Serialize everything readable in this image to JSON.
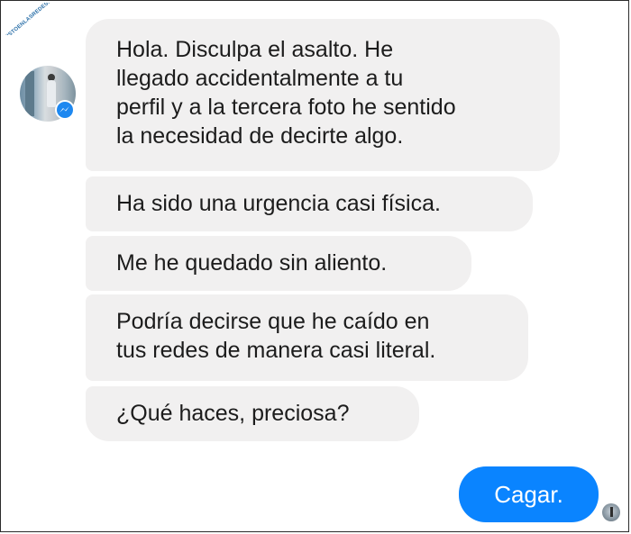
{
  "watermark": {
    "text": "VISTOENLASREDES.COM"
  },
  "conversation": {
    "received": [
      {
        "lines": [
          "Hola. Disculpa el asalto. He",
          "llegado accidentalmente a tu",
          "perfil y a la tercera foto he sentido",
          "la necesidad de decirte algo."
        ]
      },
      {
        "lines": [
          "Ha sido una urgencia casi física."
        ]
      },
      {
        "lines": [
          "Me he quedado sin aliento."
        ]
      },
      {
        "lines": [
          "Podría decirse que he caído en",
          "tus redes de manera casi literal."
        ]
      },
      {
        "lines": [
          "¿Qué haces, preciosa?"
        ]
      }
    ],
    "sent": [
      {
        "text": "Cagar."
      }
    ]
  },
  "icons": {
    "sender_avatar": "avatar-photo",
    "badge": "messenger-icon",
    "read_receipt": "read-receipt-avatar"
  },
  "colors": {
    "received_bubble": "#f1f0f0",
    "sent_bubble": "#0a84ff",
    "messenger_blue": "#1e88f0"
  }
}
